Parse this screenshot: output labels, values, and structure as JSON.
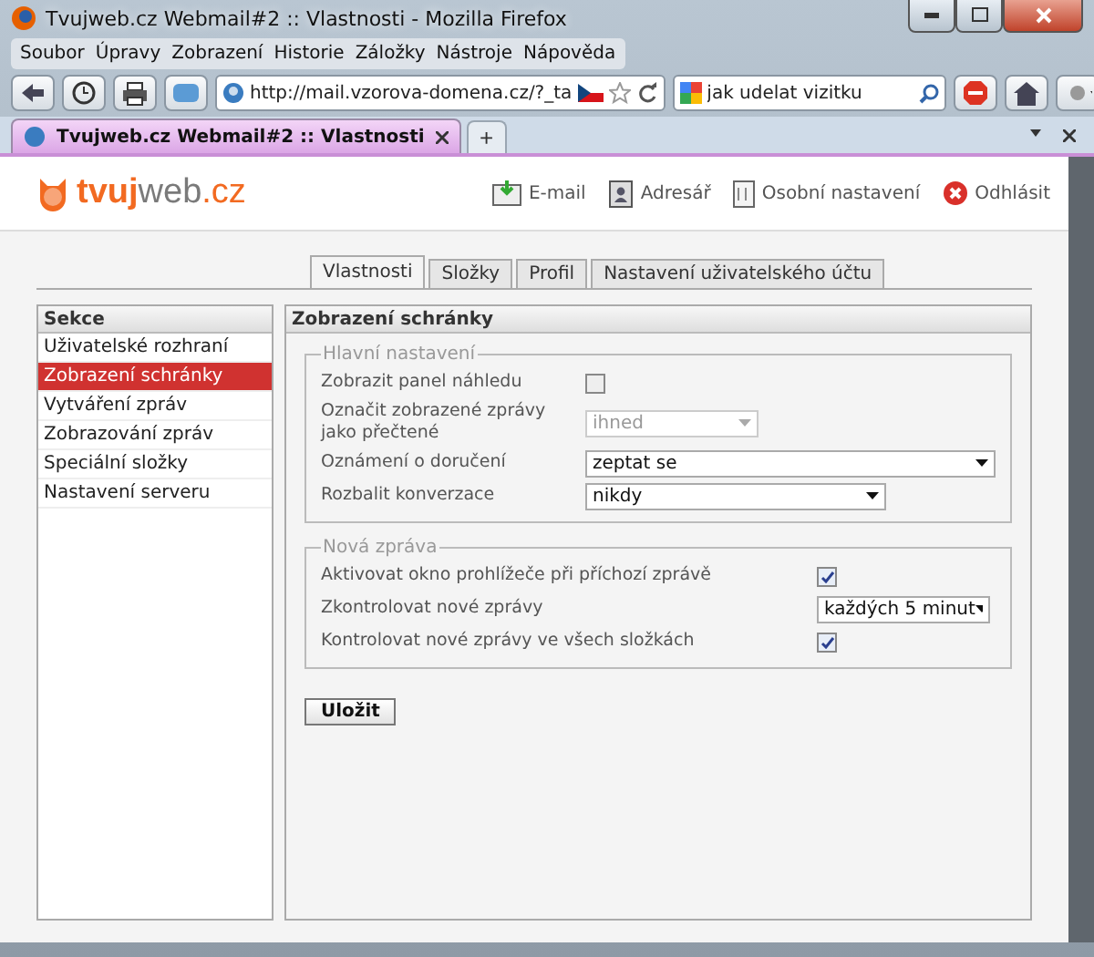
{
  "window": {
    "title": "Tvujweb.cz Webmail#2 :: Vlastnosti - Mozilla Firefox"
  },
  "menu": [
    "Soubor",
    "Úpravy",
    "Zobrazení",
    "Historie",
    "Záložky",
    "Nástroje",
    "Nápověda"
  ],
  "toolbar": {
    "url": "http://mail.vzorova-domena.cz/?_ta",
    "search_query": "jak udelat vizitku"
  },
  "browser_tabs": [
    {
      "label": "Tvujweb.cz Webmail#2 :: Vlastnosti",
      "selected": true
    }
  ],
  "new_tab": "+",
  "logo": [
    "tvuj",
    "web",
    ".cz"
  ],
  "header_links": [
    {
      "label": "E-mail",
      "kind": "mail"
    },
    {
      "label": "Adresář",
      "kind": "book"
    },
    {
      "label": "Osobní nastavení",
      "kind": "prefs"
    },
    {
      "label": "Odhlásit",
      "kind": "logout"
    }
  ],
  "tabs": [
    {
      "label": "Vlastnosti",
      "selected": true
    },
    {
      "label": "Složky",
      "selected": false
    },
    {
      "label": "Profil",
      "selected": false
    },
    {
      "label": "Nastavení uživatelského účtu",
      "selected": false
    }
  ],
  "sidebar": {
    "title": "Sekce",
    "items": [
      {
        "label": "Uživatelské rozhraní",
        "selected": false
      },
      {
        "label": "Zobrazení schránky",
        "selected": true
      },
      {
        "label": "Vytváření zpráv",
        "selected": false
      },
      {
        "label": "Zobrazování zpráv",
        "selected": false
      },
      {
        "label": "Speciální složky",
        "selected": false
      },
      {
        "label": "Nastavení serveru",
        "selected": false
      }
    ]
  },
  "panel": {
    "title": "Zobrazení schránky",
    "groups": [
      {
        "legend": "Hlavní nastavení",
        "rows": [
          {
            "label": "Zobrazit panel náhledu",
            "kind": "checkbox",
            "checked": false
          },
          {
            "label": "Označit zobrazené zprávy jako přečtené",
            "kind": "select",
            "value": "ihned",
            "disabled": true
          },
          {
            "label": "Oznámení o doručení",
            "kind": "select",
            "value": "zeptat se",
            "disabled": false
          },
          {
            "label": "Rozbalit konverzace",
            "kind": "select",
            "value": "nikdy",
            "disabled": false
          }
        ]
      },
      {
        "legend": "Nová zpráva",
        "rows": [
          {
            "label": "Aktivovat okno prohlížeče při příchozí zprávě",
            "kind": "checkbox",
            "checked": true
          },
          {
            "label": "Zkontrolovat nové zprávy",
            "kind": "select",
            "value": "každých 5 minut",
            "disabled": false
          },
          {
            "label": "Kontrolovat nové zprávy ve všech složkách",
            "kind": "checkbox",
            "checked": true
          }
        ]
      }
    ]
  },
  "save_button": "Uložit"
}
